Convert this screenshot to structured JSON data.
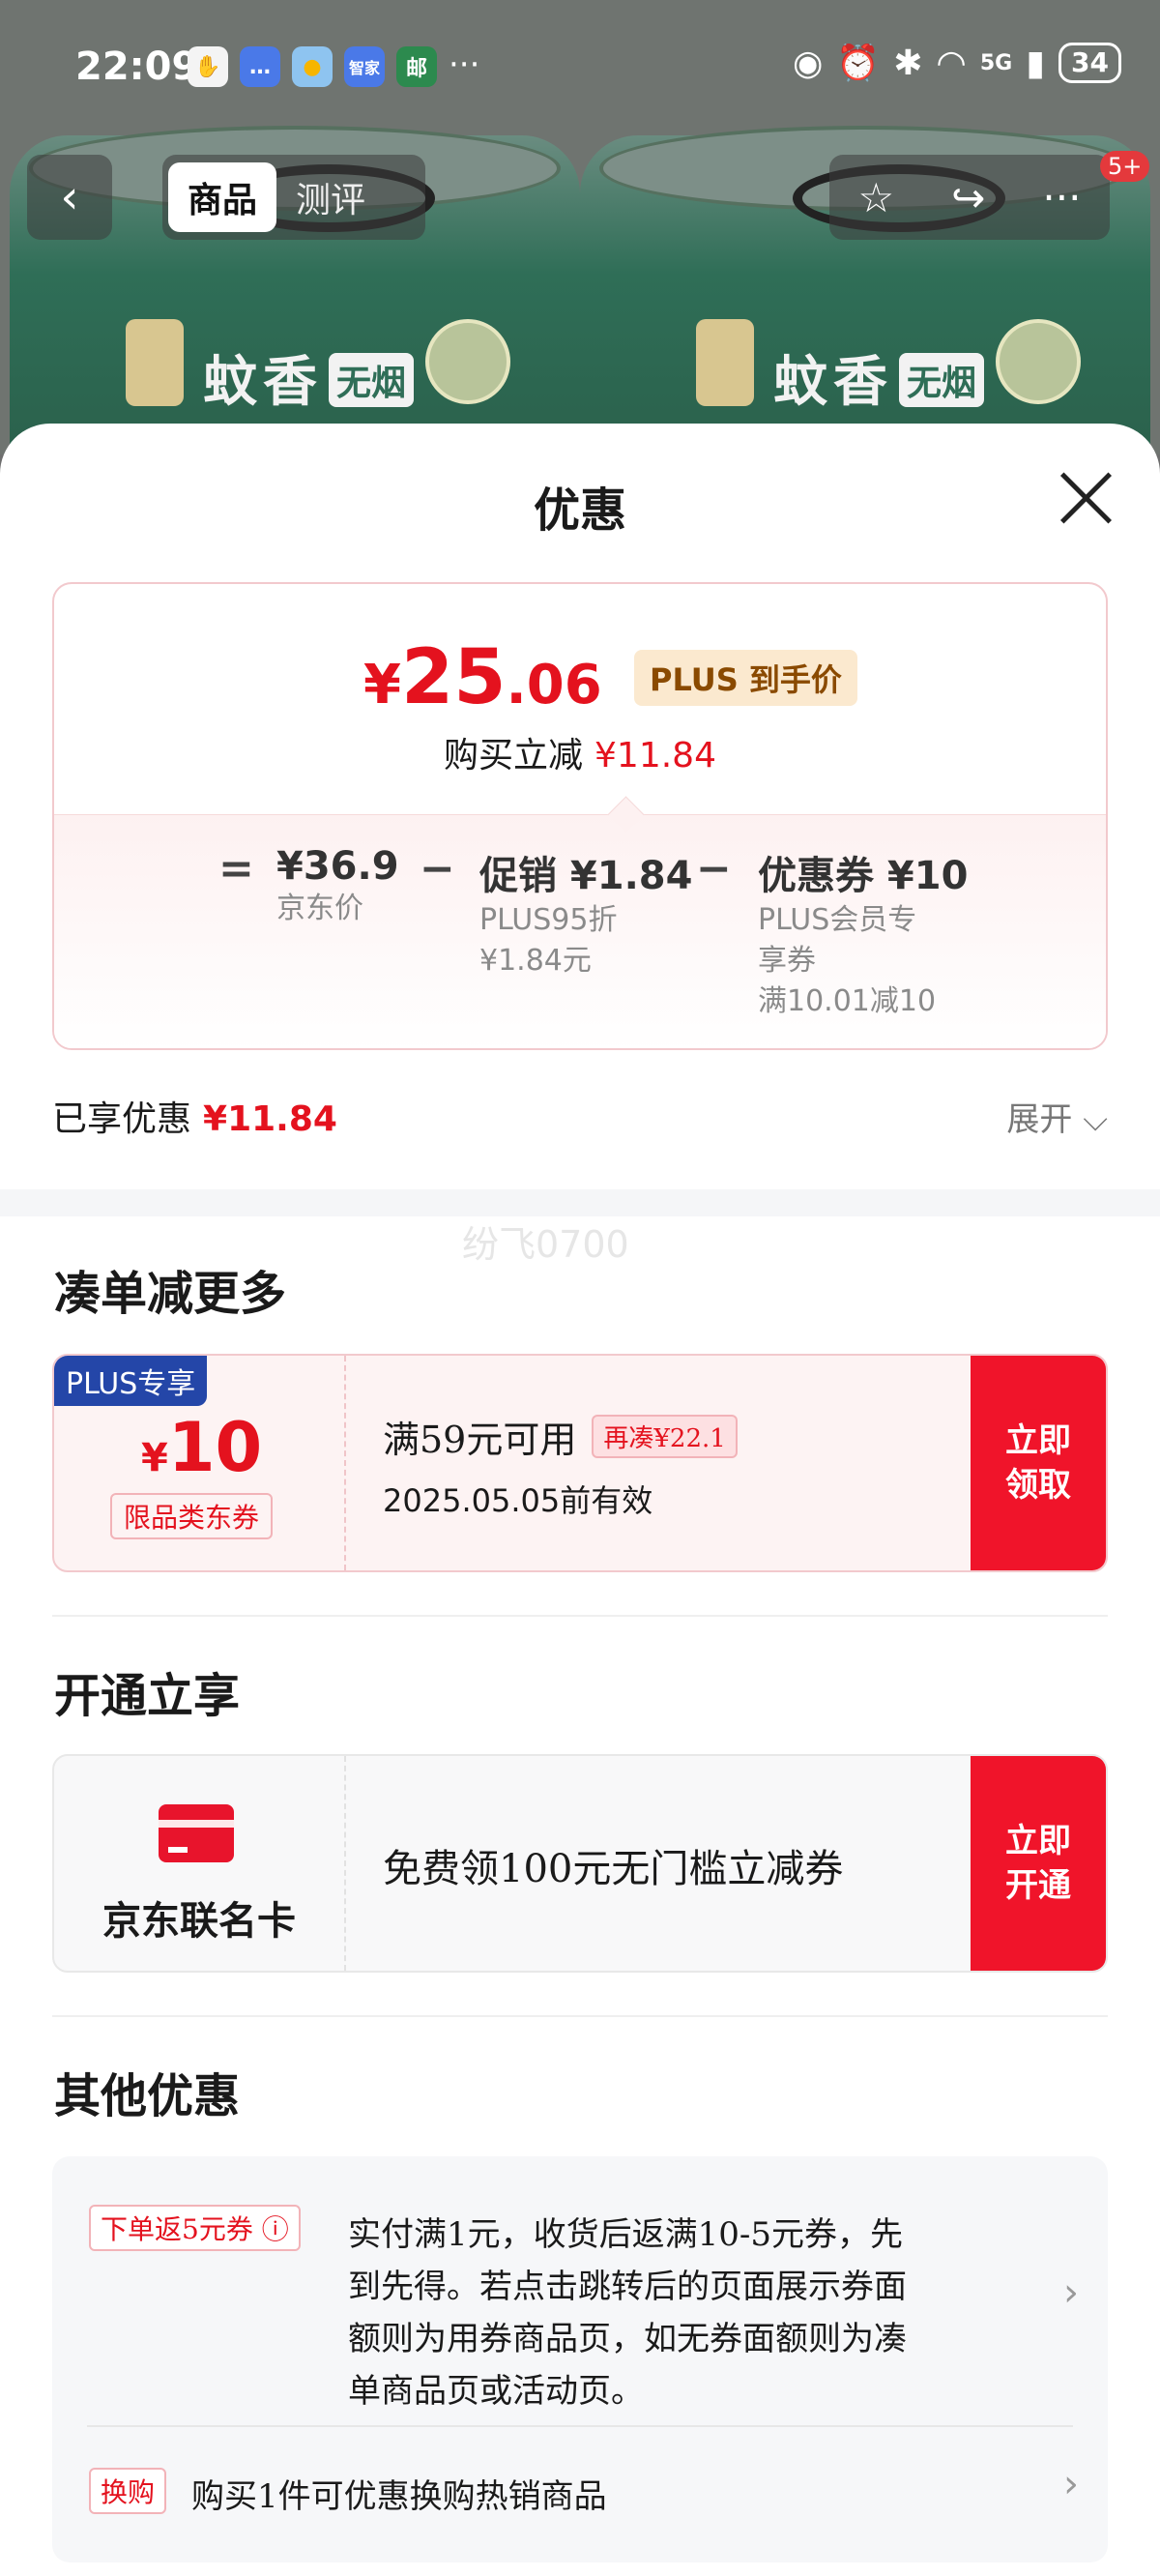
{
  "status_bar": {
    "time": "22:09",
    "app_icons": [
      "hand-icon",
      "message-icon",
      "weather-icon",
      "haier-icon",
      "post-icon"
    ],
    "haier_text": "智家",
    "more_dots": "···",
    "network": "5G",
    "battery": "34"
  },
  "nav": {
    "back_glyph": "‹",
    "tab_active": "商品",
    "tab_other": "测评",
    "cart_badge": "5+"
  },
  "product_bg": {
    "brand_text": "蚊香",
    "tag_text": "无烟"
  },
  "sheet": {
    "title": "优惠",
    "final_price": {
      "currency": "¥",
      "integer": "25",
      "decimal": ".06",
      "tag": "PLUS 到手价"
    },
    "reduce_label": "购买立减",
    "reduce_amount": "¥11.84",
    "breakdown": {
      "eq": "=",
      "minus": "−",
      "jd_price": "¥36.9",
      "jd_price_label": "京东价",
      "promo_value": "促销 ¥1.84",
      "promo_desc1": "PLUS95折",
      "promo_desc2": "¥1.84元",
      "coupon_value": "优惠券 ¥10",
      "coupon_desc1": "PLUS会员专",
      "coupon_desc2": "享券",
      "coupon_desc3": "满10.01减10"
    },
    "enjoyed_label": "已享优惠",
    "enjoyed_amount": "¥11.84",
    "expand_label": "展开 ⌵",
    "watermark": "纷飞0700"
  },
  "section_more": {
    "title": "凑单减更多",
    "coupon": {
      "ribbon": "PLUS专享",
      "currency": "¥",
      "value": "10",
      "limit": "限品类东券",
      "condition": "满59元可用",
      "more_tag": "再凑¥22.1",
      "expiry": "2025.05.05前有效",
      "button_line1": "立即",
      "button_line2": "领取"
    }
  },
  "section_open": {
    "title": "开通立享",
    "card_name": "京东联名卡",
    "card_text": "免费领100元无门槛立减券",
    "button_line1": "立即",
    "button_line2": "开通"
  },
  "section_other": {
    "title": "其他优惠",
    "item1_tag": "下单返5元券 ⓘ",
    "item1_line1": "实付满1元，收货后返满10-5元券，先",
    "item1_line2": "到先得。若点击跳转后的页面展示券面",
    "item1_line3": "额则为用券商品页，如无券面额则为凑",
    "item1_line4": "单商品页或活动页。",
    "item2_tag": "换购",
    "item2_text": "购买1件可优惠换购热销商品",
    "chevron": "›"
  },
  "colors": {
    "accent_red": "#e4121e",
    "button_red": "#f0142a",
    "plus_blue": "#2446a8",
    "plus_tag_bg": "#fbe9cf"
  }
}
